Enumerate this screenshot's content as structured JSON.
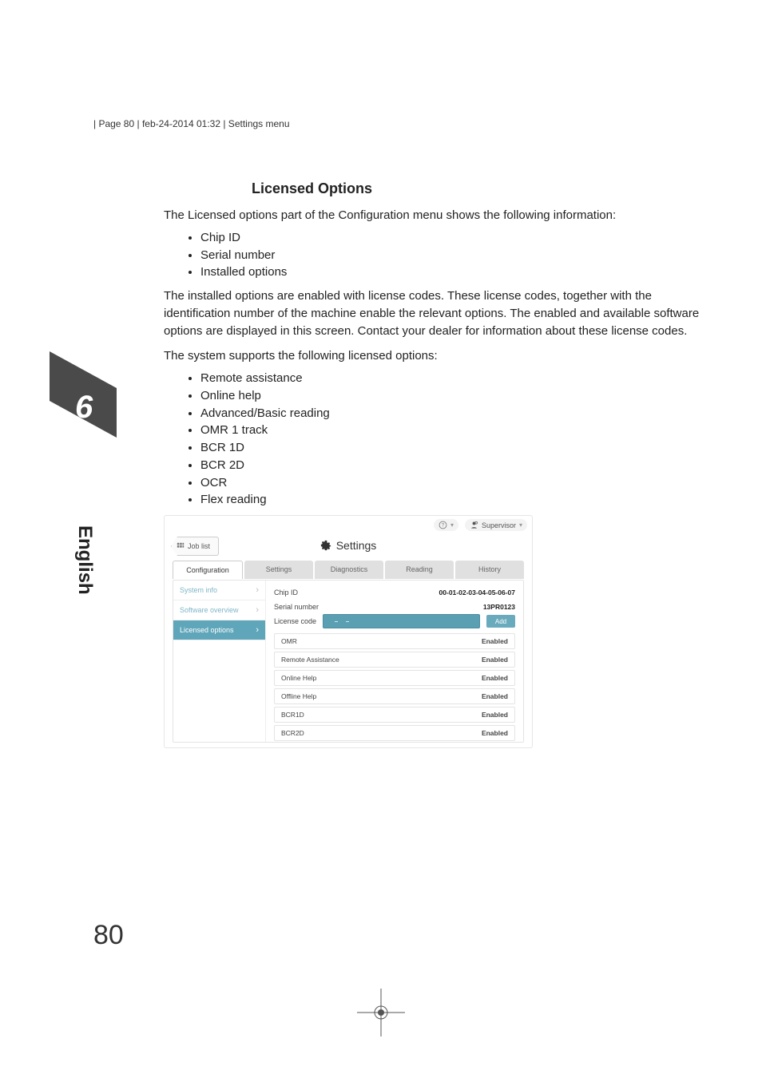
{
  "header": "| Page 80 | feb-24-2014 01:32 | Settings menu",
  "chapter_number": "6",
  "side_language": "English",
  "page_number": "80",
  "section_title": "Licensed Options",
  "para1": "The Licensed options part of the Configuration menu shows the following information:",
  "info_list": [
    "Chip ID",
    "Serial number",
    "Installed options"
  ],
  "para2": "The installed options are enabled with license codes. These license codes, together with the identification number of the machine enable the relevant options. The enabled and available software options are displayed in this screen. Contact your dealer for information about these license codes.",
  "para3": "The system supports the following licensed options:",
  "support_list": [
    "Remote assistance",
    "Online help",
    "Advanced/Basic reading",
    "OMR 1 track",
    "BCR 1D",
    "BCR 2D",
    "OCR",
    "Flex reading"
  ],
  "screenshot": {
    "topbar": {
      "supervisor": "Supervisor"
    },
    "joblist": "Job list",
    "title": "Settings",
    "tabs": [
      "Configuration",
      "Settings",
      "Diagnostics",
      "Reading",
      "History"
    ],
    "active_tab_index": 0,
    "side_items": [
      "System info",
      "Software overview",
      "Licensed options"
    ],
    "active_side_index": 2,
    "chip_id_label": "Chip ID",
    "chip_id_value": "00-01-02-03-04-05-06-07",
    "serial_label": "Serial number",
    "serial_value": "13PR0123",
    "license_code_label": "License code",
    "add_label": "Add",
    "options": [
      {
        "name": "OMR",
        "status": "Enabled"
      },
      {
        "name": "Remote Assistance",
        "status": "Enabled"
      },
      {
        "name": "Online Help",
        "status": "Enabled"
      },
      {
        "name": "Offline Help",
        "status": "Enabled"
      },
      {
        "name": "BCR1D",
        "status": "Enabled"
      },
      {
        "name": "BCR2D",
        "status": "Enabled"
      }
    ]
  }
}
